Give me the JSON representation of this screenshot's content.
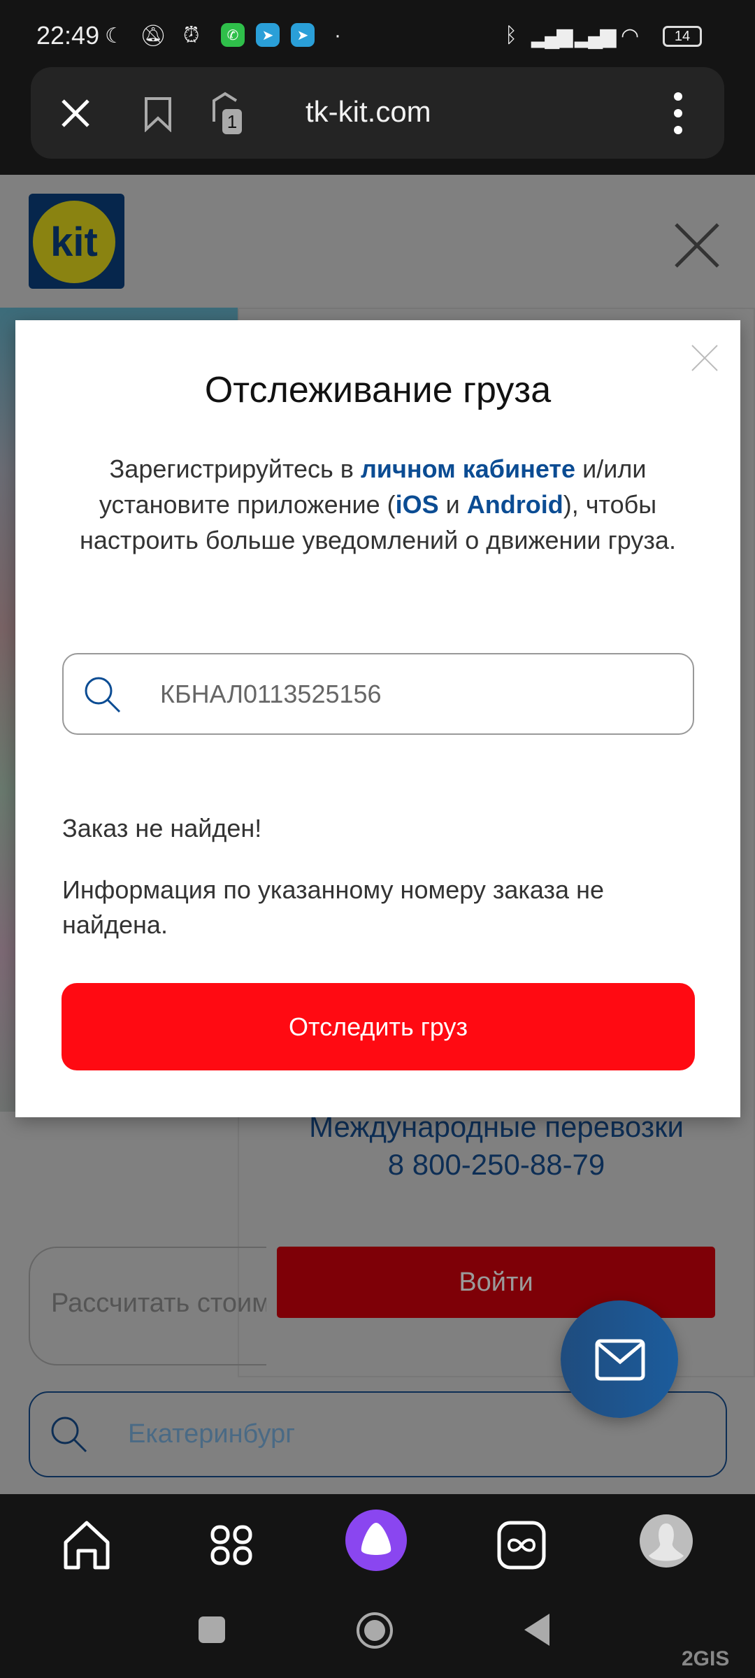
{
  "status_bar": {
    "time": "22:49",
    "battery": "14"
  },
  "browser": {
    "url": "tk-kit.com",
    "tab_count": "1"
  },
  "page": {
    "logo_text": "kit",
    "intl_title": "Международные перевозки",
    "intl_phone": "8 800-250-88-79",
    "login_label": "Войти",
    "calc_placeholder": "Рассчитать стоимость",
    "city_value": "Екатеринбург"
  },
  "modal": {
    "title": "Отслеживание груза",
    "text_1": "Зарегистрируйтесь в ",
    "link_cabinet": "личном кабинете",
    "text_2": " и/или установите приложение (",
    "link_ios": "iOS",
    "text_3": " и ",
    "link_android": "Android",
    "text_4": "), чтобы настроить больше уведомлений о движении груза.",
    "tracking_value": "КБНАЛ0113525156",
    "not_found_title": "Заказ не найден!",
    "not_found_text": "Информация по указанному номеру заказа не найдена.",
    "track_button": "Отследить груз"
  },
  "watermark": "2GIS",
  "colors": {
    "accent_red": "#ff0a12",
    "link_blue": "#0b4c93",
    "fab_blue": "#1c5c9c",
    "alice_purple": "#8a46f0"
  }
}
